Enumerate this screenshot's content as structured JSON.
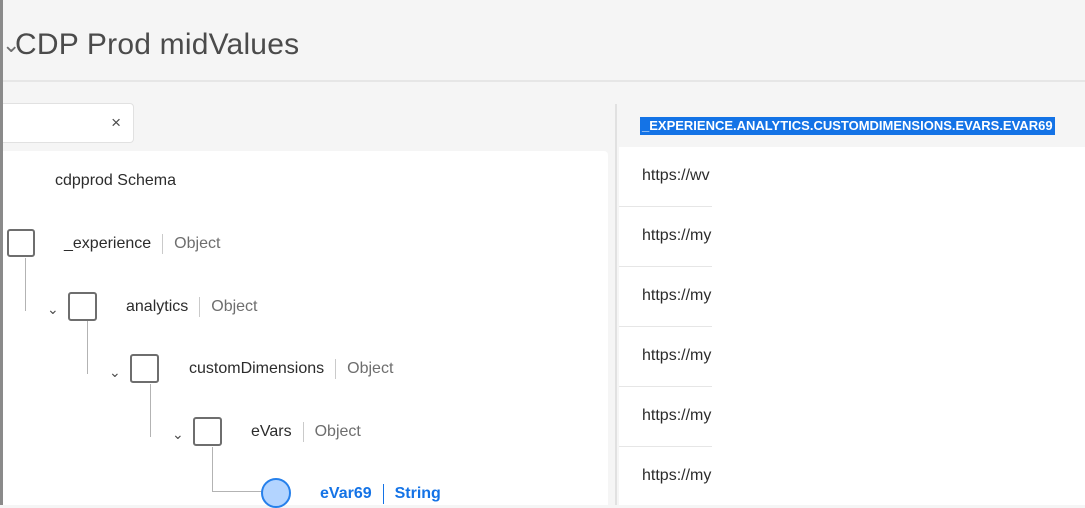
{
  "header": {
    "title": "CDP Prod midValues"
  },
  "search": {
    "value": "",
    "clear_label": "×"
  },
  "tree": {
    "root": "cdpprod Schema",
    "nodes": [
      {
        "name": "_experience",
        "type": "Object"
      },
      {
        "name": "analytics",
        "type": "Object"
      },
      {
        "name": "customDimensions",
        "type": "Object"
      },
      {
        "name": "eVars",
        "type": "Object"
      },
      {
        "name": "eVar69",
        "type": "String",
        "selected": true
      }
    ]
  },
  "values_panel": {
    "column_header": "_EXPERIENCE.ANALYTICS.CUSTOMDIMENSIONS.EVARS.EVAR69",
    "rows": [
      "https://wv",
      "https://my",
      "https://my",
      "https://my",
      "https://my",
      "https://my"
    ]
  },
  "colors": {
    "accent": "#1473e6",
    "radio_fill": "#b3d4ff"
  }
}
